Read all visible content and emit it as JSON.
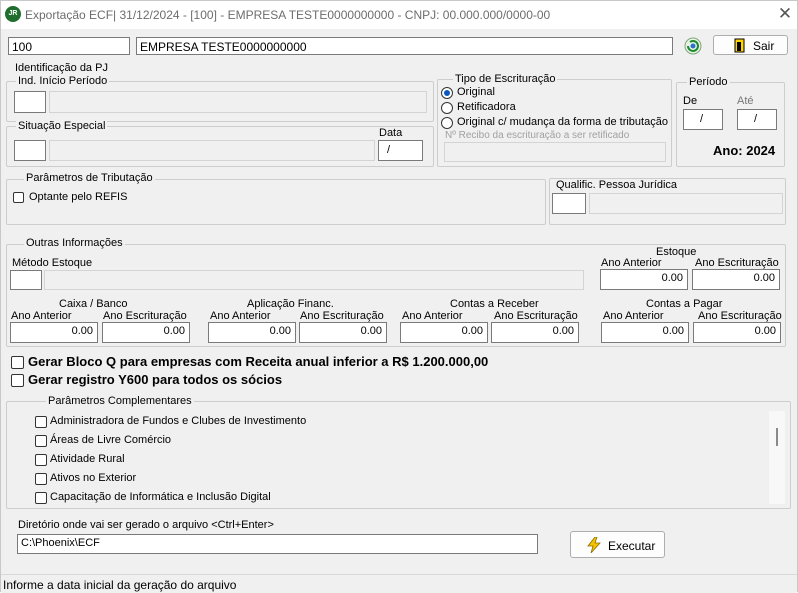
{
  "window": {
    "icon_text": "JR",
    "title": "Exportação ECF|  31/12/2024 - [100] - EMPRESA TESTE0000000000 - CNPJ: 00.000.000/0000-00"
  },
  "header": {
    "company_code": "100",
    "company_name": "EMPRESA TESTE0000000000",
    "exit_label": "Sair"
  },
  "identificacao": {
    "legend": "Identificação da PJ",
    "inicio_periodo": {
      "legend": "Ind. Início Período",
      "code": "",
      "desc": ""
    },
    "situacao_especial": {
      "legend": "Situação Especial",
      "code": "",
      "desc": "",
      "date_label": "Data",
      "date_value": "/"
    }
  },
  "tipo_escrituracao": {
    "legend": "Tipo de Escrituração",
    "options": [
      "Original",
      "Retificadora",
      "Original c/ mudança da forma de tributação"
    ],
    "selected": "Original",
    "recibo_placeholder": "Nº Recibo da escrituração a ser retificado"
  },
  "periodo": {
    "legend": "Período",
    "de_label": "De",
    "ate_label": "Até",
    "de_value": "/",
    "ate_value": "/",
    "ano_text": "Ano: 2024"
  },
  "tributacao": {
    "legend": "Parâmetros de Tributação",
    "refis_label": "Optante pelo REFIS",
    "refis_checked": false,
    "qualific_label": "Qualific. Pessoa Jurídica"
  },
  "outras": {
    "legend": "Outras Informações",
    "metodo_estoque_label": "Método Estoque",
    "estoque": {
      "title": "Estoque",
      "ano_anterior_label": "Ano Anterior",
      "ano_escrituracao_label": "Ano Escrituração",
      "ano_anterior": "0.00",
      "ano_escrituracao": "0.00"
    },
    "caixa": {
      "title": "Caixa / Banco",
      "ano_anterior_label": "Ano  Anterior",
      "ano_escrituracao_label": "Ano Escrituração",
      "ano_anterior": "0.00",
      "ano_escrituracao": "0.00"
    },
    "aplicacao": {
      "title": "Aplicação Financ.",
      "ano_anterior_label": "Ano  Anterior",
      "ano_escrituracao_label": "Ano Escrituração",
      "ano_anterior": "0.00",
      "ano_escrituracao": "0.00"
    },
    "receber": {
      "title": "Contas a Receber",
      "ano_anterior_label": "Ano Anterior",
      "ano_escrituracao_label": "Ano Escrituração",
      "ano_anterior": "0.00",
      "ano_escrituracao": "0.00"
    },
    "pagar": {
      "title": "Contas a Pagar",
      "ano_anterior_label": "Ano Anterior",
      "ano_escrituracao_label": "Ano Escrituração",
      "ano_anterior": "0.00",
      "ano_escrituracao": "0.00"
    }
  },
  "bloco_q_label": "Gerar Bloco Q para empresas com Receita anual inferior a R$ 1.200.000,00",
  "y600_label": "Gerar registro Y600 para todos os sócios",
  "complementares": {
    "legend": "Parâmetros Complementares",
    "items": [
      "Administradora de Fundos e Clubes de Investimento",
      "Áreas de Livre Comércio",
      "Atividade Rural",
      "Ativos no Exterior",
      "Capacitação de Informática e Inclusão Digital"
    ]
  },
  "diretorio": {
    "label": "Diretório onde vai ser gerado o arquivo <Ctrl+Enter>",
    "value": "C:\\Phoenix\\ECF",
    "executar_label": "Executar"
  },
  "status": "Informe a data inicial da geração do arquivo",
  "colors": {
    "accent": "#0a57c2",
    "app_icon": "#1f6e2e",
    "bolt": "#f5c400"
  }
}
